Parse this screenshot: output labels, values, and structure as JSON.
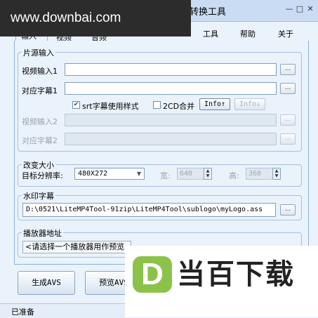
{
  "watermark": "www.downbai.com",
  "window": {
    "title_fragment": "转换工具",
    "buttons": [
      "—",
      "□",
      "✕"
    ]
  },
  "menu": {
    "items": [
      "工具",
      "帮助",
      "关于"
    ]
  },
  "tabs": [
    "输入",
    "视频",
    "音频"
  ],
  "source_group": {
    "title": "片源输入",
    "video_input_1_label": "视频输入1",
    "subtitle_1_label": "对应字幕1",
    "video_input_1_value": "",
    "subtitle_1_value": "",
    "browse_label": "...",
    "srt_style_label": "srt字幕使用样式",
    "srt_style_checked": true,
    "cd_merge_label": "2CD合并",
    "cd_merge_checked": false,
    "info_up_label": "Info↑",
    "info_down_label": "Info↓",
    "video_input_2_label": "视频输入2",
    "subtitle_2_label": "对应字幕2"
  },
  "resize_group": {
    "title": "改变大小",
    "target_label": "目标分辨率:",
    "resolution": "480X272",
    "width_label": "宽:",
    "width_value": "640",
    "height_label": "高:",
    "height_value": "360"
  },
  "watermark_group": {
    "title": "水印字幕",
    "path": "D:\\0521\\LiteMP4Tool-91zip\\LiteMP4Tool\\sublogo\\myLogo.ass",
    "browse_label": "..."
  },
  "player_group": {
    "title": "播放器地址",
    "placeholder": "<请选择一个播放器用作预览"
  },
  "actions": {
    "generate_avs": "生成AVS",
    "preview_avs": "预览AVS"
  },
  "status": {
    "text": "已准备"
  },
  "overlay_logo": {
    "letter": "D",
    "text": "当百下载",
    "color": "#8bc34a"
  }
}
